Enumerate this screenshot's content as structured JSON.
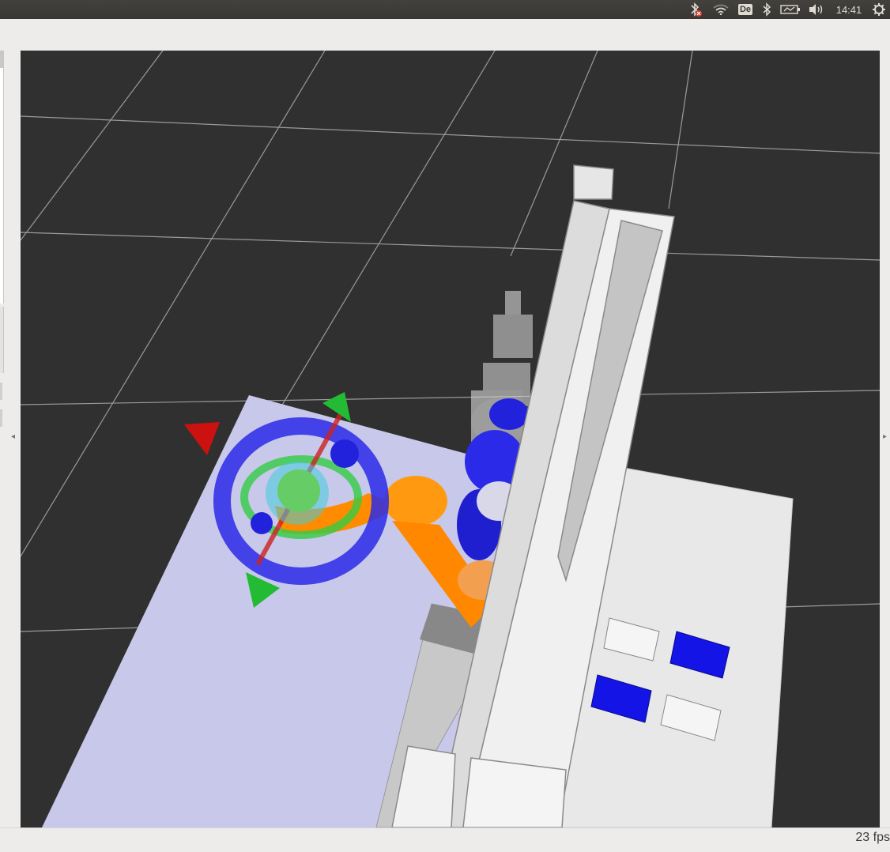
{
  "topbar": {
    "keyboard_layout": "De",
    "clock": "14:41",
    "icons": [
      "bluetooth-disabled-icon",
      "wifi-icon",
      "keyboard-layout-icon",
      "bluetooth-icon",
      "battery-icon",
      "volume-icon",
      "settings-gear-icon"
    ]
  },
  "viewport": {
    "background_color": "#303030",
    "grid_color": "#a0a0a4"
  },
  "status": {
    "fps": "23 fps"
  }
}
